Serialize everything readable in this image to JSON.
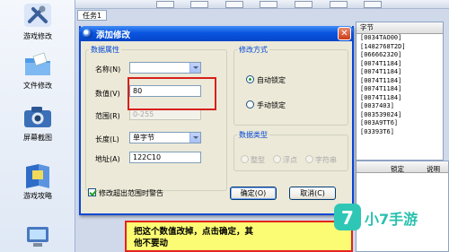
{
  "sidebar": {
    "items": [
      {
        "label": "游戏修改",
        "icon": "tools-icon"
      },
      {
        "label": "文件修改",
        "icon": "folder-icon"
      },
      {
        "label": "屏幕截图",
        "icon": "camera-icon"
      },
      {
        "label": "游戏攻略",
        "icon": "guide-book-icon"
      },
      {
        "label": "",
        "icon": "computer-icon"
      }
    ]
  },
  "background_window": {
    "task_tab": "任务1",
    "result_header": "字节",
    "result_rows": [
      "[0034TAO00]",
      "[1482768T2D]",
      "[066662320]",
      "[0074T1184]",
      "[0074T1184]",
      "[0074T1184]",
      "[0074T1184]",
      "[0074T1184]",
      "[0037403]",
      "[003539024]",
      "[003A9TT6]",
      "[03393T6]"
    ],
    "list_header_lock": "锁定",
    "list_header_hint": "说明"
  },
  "dialog": {
    "title": "添加修改",
    "close_glyph": "✕",
    "data_group": {
      "legend": "数据属性",
      "name_label": "名称(N)",
      "name_value": "",
      "value_label": "数值(V)",
      "value_value": "80",
      "range_label": "范围(R)",
      "range_value": "0-255",
      "length_label": "长度(L)",
      "length_value": "单字节",
      "address_label": "地址(A)",
      "address_value": "122C10"
    },
    "mode_group": {
      "legend": "修改方式",
      "auto_lock": "自动锁定",
      "manual_lock": "手动锁定",
      "selected": "auto_lock"
    },
    "type_group": {
      "legend": "数据类型",
      "integer": "整型",
      "float": "浮点",
      "string": "字符串"
    },
    "warn_checkbox": {
      "label": "修改超出范围时警告",
      "checked": true
    },
    "ok_button": "确定(O)",
    "cancel_button": "取消(C)"
  },
  "annotation": {
    "tip_line1": "把这个数值改掉，点击确定，其",
    "tip_line2": "他不要动",
    "highlight_color": "#d6201a",
    "tip_background": "#fcfc74"
  },
  "watermark": {
    "badge": "7",
    "text": "小7手游",
    "color": "#2ec7b5"
  }
}
